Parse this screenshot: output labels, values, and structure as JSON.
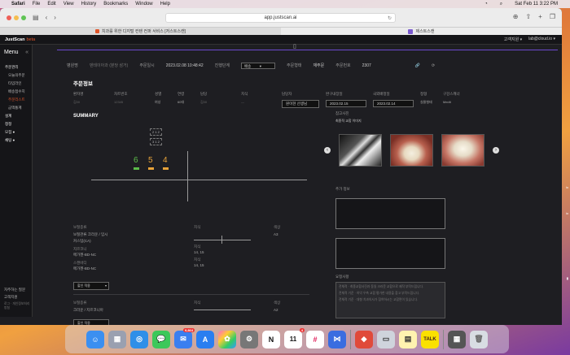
{
  "menubar": {
    "app": "Safari",
    "items": [
      "File",
      "Edit",
      "View",
      "History",
      "Bookmarks",
      "Window",
      "Help"
    ],
    "clock": "Sat Feb 11  3:22 PM"
  },
  "browser": {
    "url": "app.justscan.ai",
    "tabs": [
      {
        "label": "치과를 위한 디지털 컨텐 컨퍼 서비스 [저스트스캔]",
        "active": false
      },
      {
        "label": "제스트스캔",
        "active": true
      }
    ]
  },
  "app": {
    "brand": "JustScan",
    "beta": "beta",
    "user": "고객지원 ▾",
    "email": "lab@cloud.io ▾"
  },
  "sidebar": {
    "title": "Menu",
    "items": [
      {
        "label": "주문관리",
        "type": "group"
      },
      {
        "label": "오늘의주문",
        "type": "sub"
      },
      {
        "label": "타임라인",
        "type": "sub"
      },
      {
        "label": "배송접수지",
        "type": "sub"
      },
      {
        "label": "주문리스트",
        "type": "sub",
        "hl": true
      },
      {
        "label": "금액통계",
        "type": "sub"
      },
      {
        "label": "설계",
        "type": "group"
      },
      {
        "label": "청정",
        "type": "group"
      },
      {
        "label": "모집 ●",
        "type": "group"
      },
      {
        "label": "채팅 ●",
        "type": "group"
      }
    ],
    "bottom": [
      "자주하는 질문",
      "고객지원",
      "로그 · 개인정보처리방침"
    ]
  },
  "infobar": {
    "f1_label": "병원명",
    "f1_val": "덴테이아과 (분당 삼거)",
    "f2_label": "주문일시",
    "f2_val": "2023.02.08 10:48:42",
    "f3_label": "진행단계",
    "f3_val": "배송",
    "f4_label": "주문형태",
    "f4_val": "재주문",
    "f5_label": "주문번호",
    "f5_val": "2307"
  },
  "order": {
    "title": "주문정보",
    "labels": [
      "환자명",
      "차트번호",
      "성별",
      "연령",
      "담당",
      "치식",
      "",
      "담당자",
      "완구내장일",
      "국외배정일",
      "정형",
      "구강스캐너"
    ],
    "values": [
      "김00",
      "12345",
      "여성",
      "60대",
      "김00",
      "",
      "",
      "",
      "",
      "",
      "실물형태",
      "Medit"
    ],
    "assignee": "원이현 선생님",
    "date1": "2023.02.15",
    "date2": "2023.02.14"
  },
  "summary": {
    "title": "SUMMARY",
    "teeth_top": [
      "2 1 2",
      "3 1 2"
    ],
    "nums": [
      {
        "v": "6",
        "c": "#5cbc4a"
      },
      {
        "v": "5",
        "c": "#e8a33a"
      },
      {
        "v": "4",
        "c": "#e8a33a"
      }
    ]
  },
  "lower1": {
    "l1": "보철종류",
    "v1": "보철관류 크라운 / 임시",
    "v1b": "커스텀(CA)",
    "l2": "치식",
    "l3": "색상",
    "v3": "A3",
    "l4": "지르코니",
    "v4": "메가젠-BD-NC",
    "v4b": "14, 15",
    "l5": "스캔바디",
    "v5": "메가젠-BD-NC",
    "v5b": "14, 15",
    "btn": "할인 적용"
  },
  "lower2": {
    "l1": "보철종류",
    "v1": "크라운 / 지르코니아",
    "l2": "치식",
    "l3": "색상",
    "v3": "A2",
    "btn": "할인 적용"
  },
  "right": {
    "photo_label": "참고사진",
    "photo_sub": "최종적 교합 이미지",
    "memo_label": "추가 정보",
    "remarks_label": "요청사항",
    "remarks": [
      "전체적 · 최종교합사진과 동일 크라운 교합으로 제작 부탁드립니다.",
      "전체적 기준 · 하악 우측 교합 평가한 내용을 참고 부탁드립니다.",
      "전체적 기준 · 대형 치과의사가 참여하시는 교합면이 있습니다."
    ]
  },
  "colors": {
    "accent": "#6d4bd0",
    "brand_orange": "#e0552a",
    "green": "#5cbc4a",
    "orange": "#e8a33a"
  },
  "dock": [
    "Finder",
    "Launchpad",
    "Safari",
    "Messages",
    "Mail",
    "App Store",
    "Photos",
    "System Settings",
    "Notion",
    "Calendar",
    "Slack",
    "Share",
    "Gitpod",
    "Preview",
    "Notes",
    "KakaoTalk",
    "Screenshot",
    "Trash"
  ],
  "dock_badges": {
    "mail": "9,864",
    "calendar": "4"
  },
  "calendar_day": "11"
}
